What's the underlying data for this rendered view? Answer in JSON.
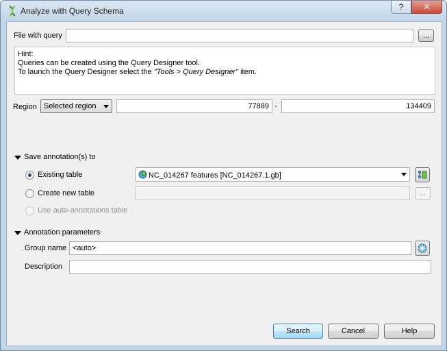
{
  "window": {
    "title": "Analyze with Query Schema",
    "help_glyph": "?",
    "close_glyph": "✕"
  },
  "file": {
    "label": "File with query",
    "value": "",
    "browse_label": "..."
  },
  "hint": {
    "line1": "Hint:",
    "line2": "Queries can be created using the Query Designer tool.",
    "line3_prefix": "To launch the Query Designer select the ",
    "line3_italic": "\"Tools > Query Designer\"",
    "line3_suffix": " item."
  },
  "region": {
    "label": "Region",
    "mode": "Selected region",
    "start": "77889",
    "separator": "-",
    "end": "134409"
  },
  "save": {
    "section_label": "Save annotation(s) to",
    "existing_label": "Existing table",
    "existing_value": "NC_014267 features [NC_014267.1.gb]",
    "new_label": "Create new table",
    "new_value": "",
    "new_browse_label": "...",
    "auto_label": "Use auto-annotations table"
  },
  "params": {
    "section_label": "Annotation parameters",
    "group_label": "Group name",
    "group_value": "<auto>",
    "desc_label": "Description",
    "desc_value": ""
  },
  "buttons": {
    "search": "Search",
    "cancel": "Cancel",
    "help": "Help"
  },
  "colors": {
    "title_bar": "#c4d6ea",
    "dialog_bg": "#f0f0f0",
    "close_button": "#c74b3b",
    "default_button": "#3c7fb1"
  }
}
